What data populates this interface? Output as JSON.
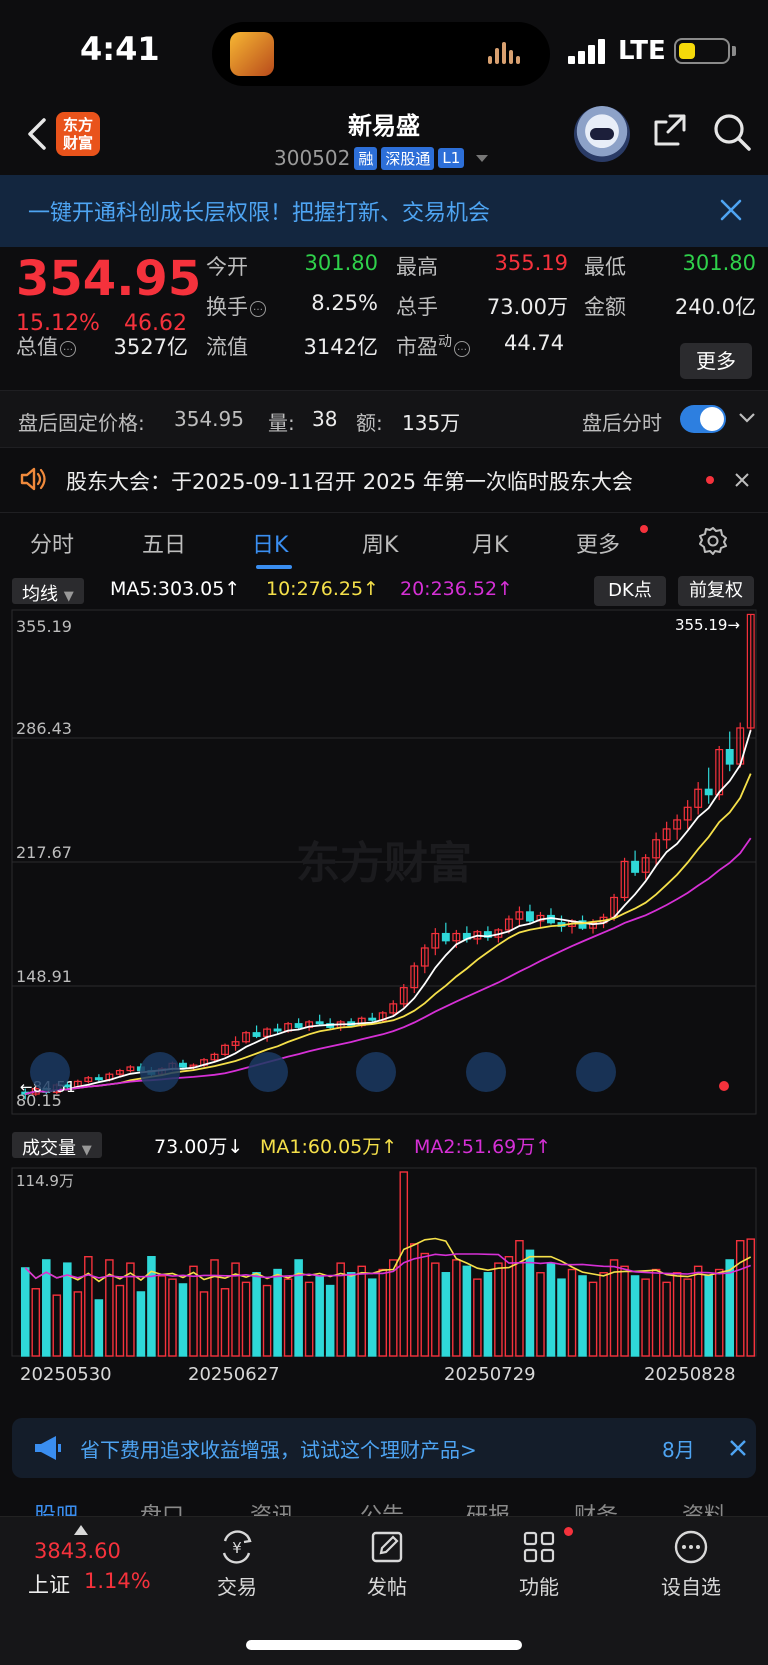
{
  "status": {
    "time": "4:41",
    "network": "LTE"
  },
  "header": {
    "stock_name": "新易盛",
    "code": "300502",
    "tags": [
      "融",
      "深股通",
      "L1"
    ],
    "logo_text": "东方财富"
  },
  "banner": {
    "text": "一键开通科创成长层权限！把握打新、交易机会"
  },
  "quote": {
    "price": "354.95",
    "pct": "15.12%",
    "change": "46.62",
    "open_label": "今开",
    "open": "301.80",
    "high_label": "最高",
    "high": "355.19",
    "low_label": "最低",
    "low": "301.80",
    "turnover_label": "换手",
    "turnover": "8.25%",
    "volume_label": "总手",
    "volume": "73.00万",
    "amount_label": "金额",
    "amount": "240.0亿",
    "mktcap_label": "总值",
    "mktcap": "3527亿",
    "float_label": "流值",
    "float": "3142亿",
    "pe_label": "市盈",
    "pe_sup": "动",
    "pe": "44.74",
    "more_label": "更多"
  },
  "after_hours": {
    "label": "盘后固定价格:",
    "price": "354.95",
    "vol_label": "量:",
    "vol": "38",
    "amt_label": "额:",
    "amt": "135万",
    "timeshare_label": "盘后分时"
  },
  "notice": {
    "text": "股东大会：于2025-09-11召开 2025 年第一次临时股东大会"
  },
  "tabs": [
    "分时",
    "五日",
    "日K",
    "周K",
    "月K",
    "更多"
  ],
  "chart_toolbar": {
    "selector": "均线",
    "ma5": "MA5:303.05↑",
    "ma10": "10:276.25↑",
    "ma20": "20:236.52↑",
    "dk_label": "DK点",
    "adjust_label": "前复权"
  },
  "volume_toolbar": {
    "selector": "成交量",
    "vol": "73.00万↓",
    "ma1": "MA1:60.05万↑",
    "ma2": "MA2:51.69万↑"
  },
  "colors": {
    "up": "#f5323c",
    "down": "#2fd8d8",
    "ma5": "#ffffff",
    "ma10": "#f5e04a",
    "ma20": "#d630d6",
    "accent": "#3a8ef0"
  },
  "chart_data": {
    "type": "candlestick",
    "y_ticks": [
      "355.19",
      "286.43",
      "217.67",
      "148.91",
      "80.15"
    ],
    "ylim": [
      80.15,
      355.19
    ],
    "last_high_label": "355.19",
    "left_low_label": "84.51",
    "x_dates": [
      "20250530",
      "20250627",
      "20250729",
      "20250828"
    ],
    "candles": [
      [
        90,
        92,
        86,
        89
      ],
      [
        89,
        93,
        88,
        92
      ],
      [
        92,
        93,
        89,
        90
      ],
      [
        90,
        95,
        89,
        94
      ],
      [
        94,
        96,
        92,
        93
      ],
      [
        93,
        97,
        92,
        96
      ],
      [
        96,
        99,
        95,
        98
      ],
      [
        98,
        100,
        96,
        97
      ],
      [
        97,
        101,
        96,
        100
      ],
      [
        100,
        103,
        99,
        102
      ],
      [
        102,
        105,
        101,
        104
      ],
      [
        104,
        106,
        101,
        102
      ],
      [
        102,
        104,
        99,
        100
      ],
      [
        100,
        104,
        99,
        103
      ],
      [
        103,
        107,
        102,
        106
      ],
      [
        106,
        108,
        103,
        104
      ],
      [
        104,
        106,
        102,
        105
      ],
      [
        105,
        109,
        104,
        108
      ],
      [
        108,
        112,
        107,
        111
      ],
      [
        111,
        117,
        110,
        116
      ],
      [
        116,
        121,
        113,
        118
      ],
      [
        118,
        124,
        117,
        123
      ],
      [
        123,
        127,
        120,
        121
      ],
      [
        121,
        126,
        118,
        125
      ],
      [
        125,
        128,
        122,
        124
      ],
      [
        124,
        129,
        123,
        128
      ],
      [
        128,
        131,
        125,
        126
      ],
      [
        126,
        130,
        124,
        129
      ],
      [
        129,
        133,
        127,
        128
      ],
      [
        128,
        131,
        125,
        126
      ],
      [
        126,
        130,
        124,
        129
      ],
      [
        129,
        131,
        126,
        127
      ],
      [
        127,
        132,
        126,
        131
      ],
      [
        131,
        134,
        129,
        130
      ],
      [
        130,
        135,
        129,
        134
      ],
      [
        134,
        141,
        132,
        139
      ],
      [
        139,
        150,
        137,
        148
      ],
      [
        148,
        162,
        145,
        160
      ],
      [
        160,
        172,
        156,
        170
      ],
      [
        170,
        181,
        166,
        178
      ],
      [
        178,
        184,
        172,
        174
      ],
      [
        174,
        180,
        170,
        178
      ],
      [
        178,
        182,
        173,
        175
      ],
      [
        175,
        180,
        172,
        179
      ],
      [
        179,
        182,
        174,
        176
      ],
      [
        176,
        181,
        173,
        180
      ],
      [
        180,
        188,
        178,
        186
      ],
      [
        186,
        193,
        182,
        190
      ],
      [
        190,
        194,
        183,
        185
      ],
      [
        185,
        190,
        181,
        188
      ],
      [
        188,
        192,
        183,
        184
      ],
      [
        184,
        188,
        179,
        182
      ],
      [
        182,
        186,
        178,
        185
      ],
      [
        185,
        188,
        180,
        181
      ],
      [
        181,
        186,
        178,
        184
      ],
      [
        184,
        189,
        181,
        187
      ],
      [
        187,
        200,
        185,
        198
      ],
      [
        198,
        220,
        196,
        218
      ],
      [
        218,
        224,
        210,
        212
      ],
      [
        212,
        222,
        208,
        220
      ],
      [
        220,
        234,
        216,
        230
      ],
      [
        230,
        240,
        225,
        236
      ],
      [
        236,
        244,
        230,
        241
      ],
      [
        241,
        252,
        236,
        248
      ],
      [
        248,
        262,
        244,
        258
      ],
      [
        258,
        270,
        250,
        255
      ],
      [
        255,
        282,
        252,
        280
      ],
      [
        280,
        290,
        268,
        272
      ],
      [
        272,
        295,
        270,
        292
      ],
      [
        292,
        355.19,
        290,
        354.95
      ]
    ],
    "volume_ylim_label": "114.9万",
    "volumes": [
      55,
      42,
      60,
      38,
      58,
      40,
      62,
      35,
      60,
      44,
      58,
      40,
      62,
      50,
      48,
      45,
      56,
      40,
      60,
      42,
      58,
      46,
      52,
      44,
      54,
      48,
      60,
      46,
      50,
      44,
      58,
      52,
      56,
      48,
      54,
      60,
      114.9,
      70,
      64,
      58,
      52,
      60,
      56,
      48,
      52,
      58,
      62,
      72,
      66,
      52,
      58,
      48,
      54,
      50,
      46,
      52,
      60,
      56,
      50,
      48,
      54,
      46,
      52,
      48,
      56,
      50,
      54,
      60,
      72,
      73
    ]
  },
  "ad": {
    "text": "省下费用追求收益增强，试试这个理财产品>",
    "month": "8月"
  },
  "peek_tabs": [
    "股吧",
    "盘口",
    "资讯",
    "公告",
    "研报",
    "财务",
    "资料"
  ],
  "nav": {
    "index_value": "3843.60",
    "index_name": "上证",
    "index_pct": "1.14%",
    "items": [
      "交易",
      "发帖",
      "功能",
      "设自选"
    ]
  }
}
